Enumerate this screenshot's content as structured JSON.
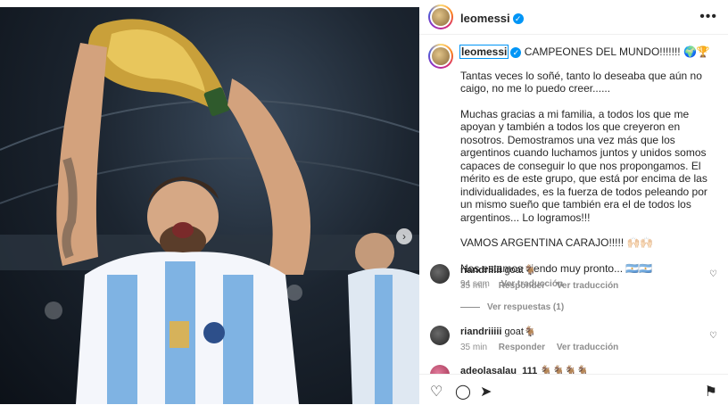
{
  "header": {
    "username": "leomessi"
  },
  "caption": {
    "username": "leomessi",
    "headline": "CAMPEONES DEL MUNDO!!!!!!! 🌍🏆",
    "paragraphs": [
      "Tantas veces lo soñé, tanto lo deseaba que aún no caigo, no me lo puedo creer......",
      "Muchas gracias a mi familia, a todos los que me apoyan y también a todos los que creyeron en nosotros. Demostramos una vez más que los argentinos cuando luchamos juntos y unidos somos capaces de conseguir lo que nos propongamos. El mérito es de este grupo, que está por encima de las individualidades, es la fuerza de todos peleando por un mismo sueño que también era el de todos los argentinos... Lo logramos!!!",
      "VAMOS ARGENTINA CARAJO!!!!! 🙌🏻🙌🏻",
      "Nos estamos viendo muy pronto... 🇦🇷🇦🇷"
    ],
    "time": "94 sem",
    "translate": "Ver traducción"
  },
  "comments": [
    {
      "user": "riandriiiii",
      "text": "goat🐐",
      "time": "35 min",
      "reply": "Responder",
      "translate": "Ver traducción",
      "view_replies": "Ver respuestas (1)"
    },
    {
      "user": "riandriiiii",
      "text": "goat🐐",
      "time": "35 min",
      "reply": "Responder",
      "translate": "Ver traducción"
    },
    {
      "user": "adeolasalau_111",
      "text": "🐐🐐🐐🐐"
    }
  ],
  "icons": {
    "like": "heart-icon",
    "comment": "comment-icon",
    "share": "share-icon",
    "save": "bookmark-icon",
    "more": "more-options-icon",
    "next": "chevron-right-icon"
  }
}
